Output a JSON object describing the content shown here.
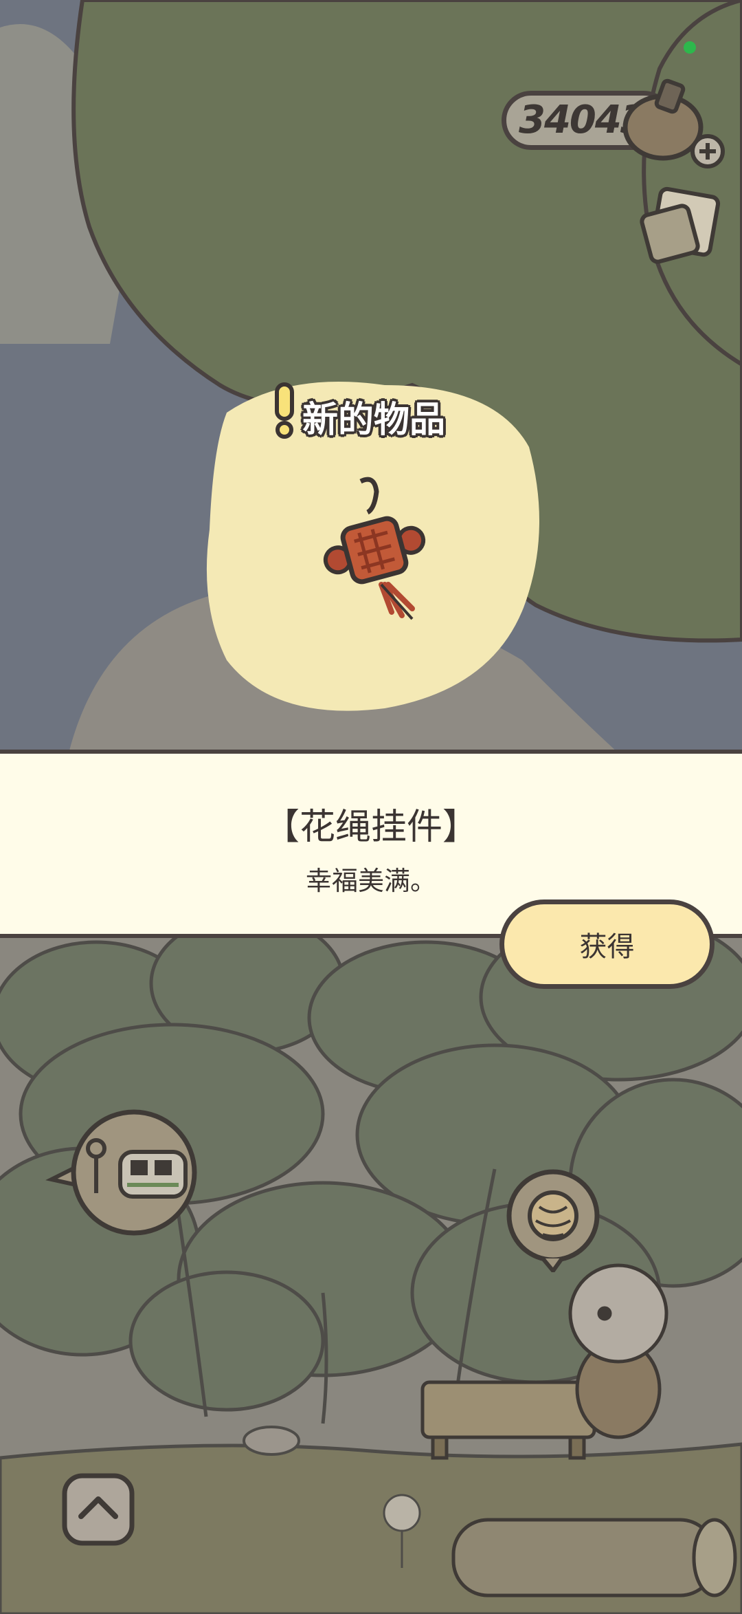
{
  "hud": {
    "clover_count": "340431"
  },
  "popup": {
    "header_label": "新的物品",
    "item_name": "【花绳挂件】",
    "item_description": "幸福美满。",
    "obtain_button_label": "获得"
  },
  "colors": {
    "sky": "#6e7480",
    "tree_green": "#6b7458",
    "glow_yellow": "#f4e9b5",
    "info_band": "#fffce9",
    "button_fill": "#fbe8ad",
    "outline": "#4a4240"
  },
  "icons": {
    "clover": "clover-pouch-icon",
    "add": "plus-icon",
    "letters": "letters-icon",
    "item": "chinese-knot-icon",
    "exclamation": "exclamation-icon",
    "train": "train-bubble-icon",
    "yarn": "yarn-bubble-icon",
    "expand": "chevron-up-icon"
  }
}
